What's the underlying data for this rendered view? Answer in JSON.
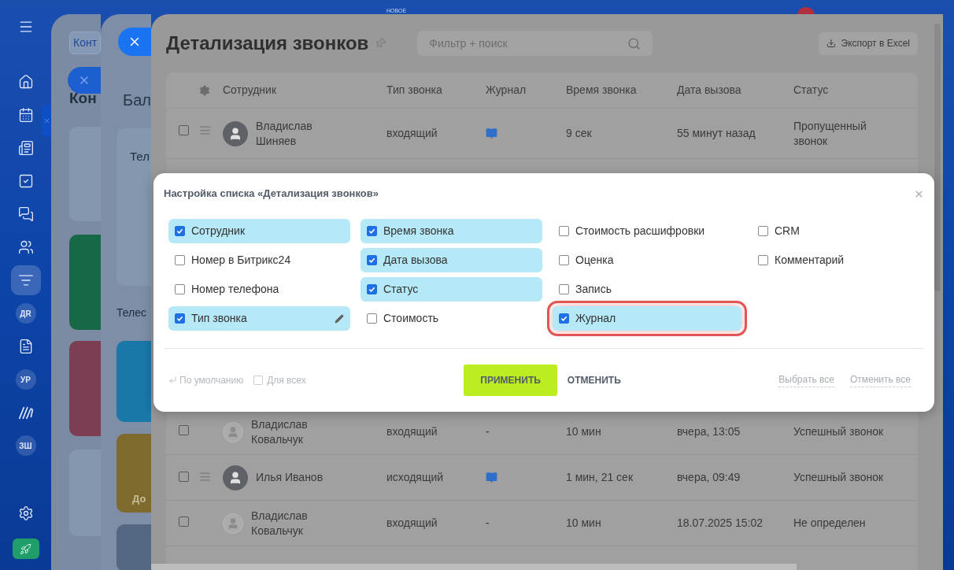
{
  "sidebar": {
    "items": [
      {
        "kind": "icon",
        "selected": false
      },
      {
        "kind": "icon",
        "selected": false
      },
      {
        "kind": "icon",
        "selected": false
      },
      {
        "kind": "icon",
        "selected": false
      },
      {
        "kind": "icon",
        "selected": false
      },
      {
        "kind": "icon",
        "selected": false
      },
      {
        "kind": "icon",
        "selected": false
      },
      {
        "kind": "icon",
        "selected": true
      },
      {
        "kind": "initials",
        "label": "ДR",
        "selected": false
      },
      {
        "kind": "icon",
        "selected": false
      },
      {
        "kind": "initials",
        "label": "УР",
        "selected": false
      },
      {
        "kind": "icon",
        "selected": false
      },
      {
        "kind": "initials",
        "label": "ЗШ",
        "selected": false
      }
    ]
  },
  "top_label": "НОВОЕ",
  "back_panel_1": {
    "chip": "Конт",
    "heading": "Кон"
  },
  "back_panel_2": {
    "heading": "Бал",
    "card_title": "Тел",
    "section": "Телес",
    "card_label": "До"
  },
  "page": {
    "title": "Детализация звонков",
    "search": {
      "placeholder": "Фильтр + поиск"
    },
    "export_button": "Экспорт в Excel"
  },
  "table": {
    "columns": [
      "Сотрудник",
      "Тип звонка",
      "Журнал",
      "Время звонка",
      "Дата вызова",
      "Статус"
    ],
    "rows": [
      {
        "name": "Владислав Шиняев",
        "inactive": false,
        "type": "входящий",
        "journal_icon": true,
        "time": "9 сек",
        "date": "55 минут назад",
        "status": "Пропущенный звонок",
        "selected": false
      },
      {
        "name": "Владислав Ковальчук",
        "inactive": true,
        "type": "входящий",
        "journal_icon": false,
        "journal": "-",
        "time": "10 мин",
        "date": "вчера, 13:05",
        "status": "Успешный звонок",
        "selected": false
      },
      {
        "name": "Илья Иванов",
        "inactive": false,
        "type": "исходящий",
        "journal_icon": true,
        "time": "1 мин, 21 сек",
        "date": "вчера, 09:49",
        "status": "Успешный звонок",
        "selected": false
      },
      {
        "name": "Владислав Ковальчук",
        "inactive": true,
        "type": "входящий",
        "journal_icon": false,
        "journal": "-",
        "time": "10 мин",
        "date": "18.07.2025 15:02",
        "status": "Не определен",
        "selected": false
      }
    ]
  },
  "dialog": {
    "title": "Настройка списка «Детализация звонков»",
    "columns": [
      {
        "items": [
          {
            "label": "Сотрудник",
            "checked": true,
            "editable": false,
            "highlighted": false
          },
          {
            "label": "Номер в Битрикс24",
            "checked": false,
            "editable": false,
            "highlighted": false
          },
          {
            "label": "Номер телефона",
            "checked": false,
            "editable": false,
            "highlighted": false
          },
          {
            "label": "Тип звонка",
            "checked": true,
            "editable": true,
            "highlighted": false
          }
        ]
      },
      {
        "items": [
          {
            "label": "Время звонка",
            "checked": true,
            "editable": false,
            "highlighted": false
          },
          {
            "label": "Дата вызова",
            "checked": true,
            "editable": false,
            "highlighted": false
          },
          {
            "label": "Статус",
            "checked": true,
            "editable": false,
            "highlighted": false
          },
          {
            "label": "Стоимость",
            "checked": false,
            "editable": false,
            "highlighted": false
          }
        ]
      },
      {
        "items": [
          {
            "label": "Стоимость расшифровки",
            "checked": false,
            "editable": false,
            "highlighted": false
          },
          {
            "label": "Оценка",
            "checked": false,
            "editable": false,
            "highlighted": false
          },
          {
            "label": "Запись",
            "checked": false,
            "editable": false,
            "highlighted": false
          },
          {
            "label": "Журнал",
            "checked": true,
            "editable": false,
            "highlighted": true
          }
        ]
      },
      {
        "items": [
          {
            "label": "CRM",
            "checked": false,
            "editable": false,
            "highlighted": false
          },
          {
            "label": "Комментарий",
            "checked": false,
            "editable": false,
            "highlighted": false
          }
        ]
      }
    ],
    "default_link": "По умолчанию",
    "for_all": {
      "label": "Для всех",
      "checked": false
    },
    "apply_button": "ПРИМЕНИТЬ",
    "cancel_button": "ОТМЕНИТЬ",
    "select_all": "Выбрать все",
    "deselect_all": "Отменить все"
  }
}
